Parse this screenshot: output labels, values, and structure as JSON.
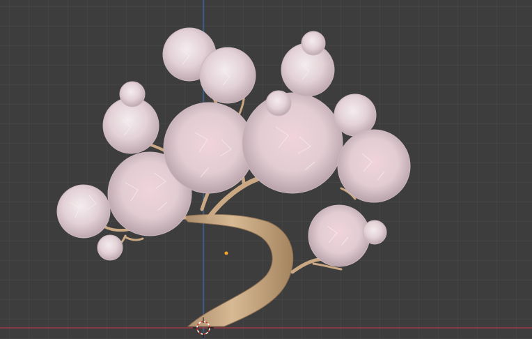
{
  "viewport": {
    "background": "#3d3d3d",
    "grid_minor_color": "#464646",
    "grid_major_color": "#4a4a4a",
    "axis_x_color": "#b23a48",
    "axis_z_color": "#3a6fb0",
    "origin_color": "#f5a623"
  },
  "scene": {
    "object": "cherry-blossom-tree",
    "bark_color": "#c9a883",
    "blossom_color": "#eadde0",
    "blossom_shadow": "#c8b3ba",
    "blossom_tint": "#e8b8c6"
  }
}
